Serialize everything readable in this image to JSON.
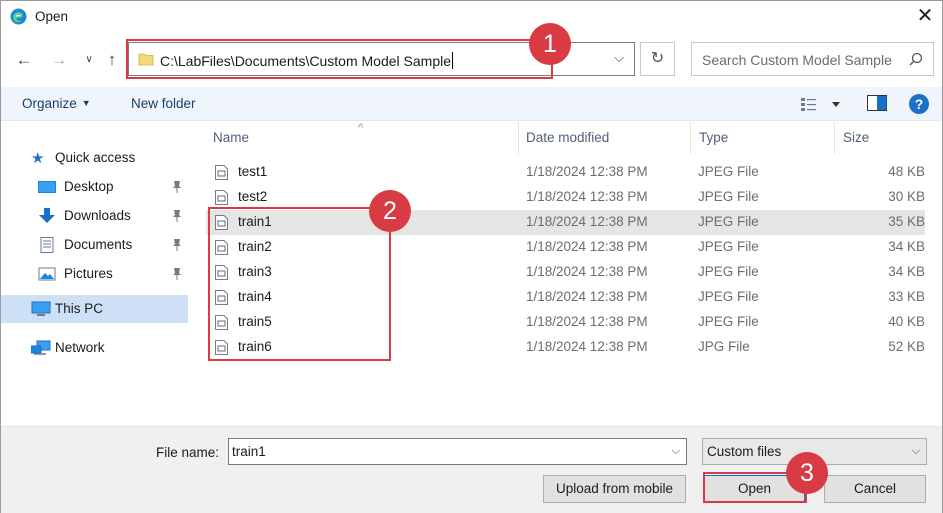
{
  "window": {
    "title": "Open"
  },
  "address": {
    "path": "C:\\LabFiles\\Documents\\Custom Model Sample"
  },
  "search": {
    "placeholder": "Search Custom Model Sample"
  },
  "toolbar": {
    "organize_label": "Organize",
    "new_folder_label": "New folder"
  },
  "nav": {
    "quick_access": "Quick access",
    "desktop": "Desktop",
    "downloads": "Downloads",
    "documents": "Documents",
    "pictures": "Pictures",
    "this_pc": "This PC",
    "network": "Network"
  },
  "columns": {
    "name": "Name",
    "date": "Date modified",
    "type": "Type",
    "size": "Size"
  },
  "files": [
    {
      "name": "test1",
      "date": "1/18/2024 12:38 PM",
      "type": "JPEG File",
      "size": "48 KB"
    },
    {
      "name": "test2",
      "date": "1/18/2024 12:38 PM",
      "type": "JPEG File",
      "size": "30 KB"
    },
    {
      "name": "train1",
      "date": "1/18/2024 12:38 PM",
      "type": "JPEG File",
      "size": "35 KB"
    },
    {
      "name": "train2",
      "date": "1/18/2024 12:38 PM",
      "type": "JPEG File",
      "size": "34 KB"
    },
    {
      "name": "train3",
      "date": "1/18/2024 12:38 PM",
      "type": "JPEG File",
      "size": "34 KB"
    },
    {
      "name": "train4",
      "date": "1/18/2024 12:38 PM",
      "type": "JPEG File",
      "size": "33 KB"
    },
    {
      "name": "train5",
      "date": "1/18/2024 12:38 PM",
      "type": "JPEG File",
      "size": "40 KB"
    },
    {
      "name": "train6",
      "date": "1/18/2024 12:38 PM",
      "type": "JPG File",
      "size": "52 KB"
    }
  ],
  "footer": {
    "file_name_label": "File name:",
    "file_name_value": "train1",
    "filter_value": "Custom files",
    "upload_label": "Upload from mobile",
    "open_label": "Open",
    "cancel_label": "Cancel"
  },
  "annotations": {
    "badge1": "1",
    "badge2": "2",
    "badge3": "3"
  },
  "colors": {
    "annotation": "#d83b44",
    "accent": "#1c6fc9",
    "selection": "#e5e5e5"
  }
}
